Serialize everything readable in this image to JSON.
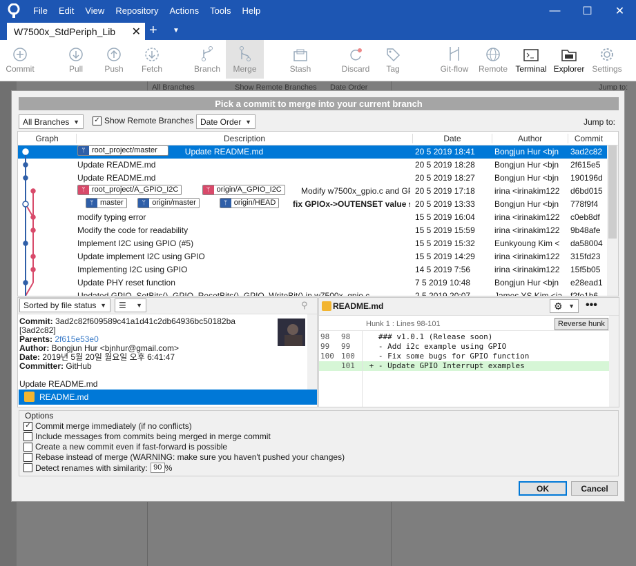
{
  "menu": [
    "File",
    "Edit",
    "View",
    "Repository",
    "Actions",
    "Tools",
    "Help"
  ],
  "tab": {
    "title": "W7500x_StdPeriph_Lib"
  },
  "toolbar": {
    "commit": "Commit",
    "pull": "Pull",
    "push": "Push",
    "fetch": "Fetch",
    "branch": "Branch",
    "merge": "Merge",
    "stash": "Stash",
    "discard": "Discard",
    "tag": "Tag",
    "gitflow": "Git-flow",
    "remote": "Remote",
    "terminal": "Terminal",
    "explorer": "Explorer",
    "settings": "Settings"
  },
  "background": {
    "branches": "All Branches",
    "show_remote": "Show Remote Branches",
    "order": "Date Order",
    "jump": "Jump to:"
  },
  "dialog": {
    "title": "Pick a commit to merge into your current branch",
    "branches_select": "All Branches",
    "show_remote": "Show Remote Branches",
    "order_select": "Date Order",
    "jump_to": "Jump to:",
    "columns": {
      "graph": "Graph",
      "description": "Description",
      "date": "Date",
      "author": "Author",
      "commit": "Commit"
    },
    "commits": [
      {
        "tags": [
          {
            "t": "root_project/master",
            "c": "blue"
          }
        ],
        "desc": "Update README.md",
        "date": "20 5 2019 18:41",
        "author": "Bongjun Hur <bjn",
        "hash": "3ad2c82",
        "selected": true
      },
      {
        "tags": [],
        "desc": "Update README.md",
        "date": "20 5 2019 18:28",
        "author": "Bongjun Hur <bjn",
        "hash": "2f615e5"
      },
      {
        "tags": [],
        "desc": "Update README.md",
        "date": "20 5 2019 18:27",
        "author": "Bongjun Hur <bjn",
        "hash": "190196d"
      },
      {
        "tags": [
          {
            "t": "root_project/A_GPIO_I2C",
            "c": "red"
          },
          {
            "t": "origin/A_GPIO_I2C",
            "c": "red"
          }
        ],
        "desc": "Modify w7500x_gpio.c  and GPIO",
        "date": "20 5 2019 17:18",
        "author": "irina <irinakim122",
        "hash": "d6bd015"
      },
      {
        "tags": [
          {
            "t": "master",
            "c": "blue"
          },
          {
            "t": "origin/master",
            "c": "blue"
          },
          {
            "t": "origin/HEAD",
            "c": "blue"
          }
        ],
        "desc": "fix GPIOx->OUTENSET value s",
        "date": "20 5 2019 13:33",
        "author": "Bongjun Hur <bjn",
        "hash": "778f9f4",
        "bold": true
      },
      {
        "tags": [],
        "desc": "modify  typing error",
        "date": "15 5 2019 16:04",
        "author": "irina <irinakim122",
        "hash": "c0eb8df"
      },
      {
        "tags": [],
        "desc": "Modify the code for readability",
        "date": "15 5 2019 15:59",
        "author": "irina <irinakim122",
        "hash": "9b48afe"
      },
      {
        "tags": [],
        "desc": "Implement I2C using GPIO (#5)",
        "date": "15 5 2019 15:32",
        "author": "Eunkyoung Kim <",
        "hash": "da58004"
      },
      {
        "tags": [],
        "desc": "Update implement I2C using GPIO",
        "date": "15 5 2019 14:29",
        "author": "irina <irinakim122",
        "hash": "315fd23"
      },
      {
        "tags": [],
        "desc": "Implementing I2C using GPIO",
        "date": "14 5 2019 7:56",
        "author": "irina <irinakim122",
        "hash": "15f5b05"
      },
      {
        "tags": [],
        "desc": "Update PHY reset function",
        "date": "7 5 2019 10:48",
        "author": "Bongjun Hur <bjn",
        "hash": "e28ead1"
      },
      {
        "tags": [],
        "desc": "Updated GPIO_SetBits(), GPIO_ResetBits(), GPIO_WriteBit() in w7500x_gpio.c",
        "date": "2 5 2019 20:07",
        "author": "James YS Kim <ja",
        "hash": "f2fe1b6"
      }
    ],
    "sort_select": "Sorted by file status",
    "commit_info": {
      "commit_label": "Commit:",
      "commit_value": "3ad2c82f609589c41a1d41c2db64936bc50182ba",
      "short": "[3ad2c82]",
      "parents_label": "Parents:",
      "parents_value": "2f615e53e0",
      "author_label": "Author:",
      "author_value": "Bongjun Hur <bjnhur@gmail.com>",
      "date_label": "Date:",
      "date_value": "2019년 5월 20일 월요일 오후 6:41:47",
      "committer_label": "Committer:",
      "committer_value": "GitHub",
      "message": "Update README.md"
    },
    "file_selected": "README.md",
    "diff": {
      "file": "README.md",
      "hunk": "Hunk 1 : Lines 98-101",
      "reverse": "Reverse hunk",
      "lines": [
        {
          "o": "98",
          "n": "98",
          "t": "   ### v1.0.1 (Release soon)",
          "add": false
        },
        {
          "o": "99",
          "n": "99",
          "t": "   - Add i2c example using GPIO",
          "add": false
        },
        {
          "o": "100",
          "n": "100",
          "t": "   - Fix some bugs for GPIO function",
          "add": false
        },
        {
          "o": "",
          "n": "101",
          "t": " + - Update GPIO Interrupt examples",
          "add": true
        }
      ]
    },
    "options": {
      "title": "Options",
      "o1": "Commit merge immediately (if no conflicts)",
      "o2": "Include messages from commits being merged in merge commit",
      "o3": "Create a new commit even if fast-forward is possible",
      "o4": "Rebase instead of merge (WARNING: make sure you haven't pushed your changes)",
      "o5": "Detect renames with similarity:",
      "similarity": "90",
      "pct": "%"
    },
    "ok": "OK",
    "cancel": "Cancel"
  },
  "colors": {
    "title_blue": "#1d56b3",
    "select_blue": "#0078d7",
    "branch_blue": "#2f5fa8",
    "branch_red": "#d84a6a"
  }
}
